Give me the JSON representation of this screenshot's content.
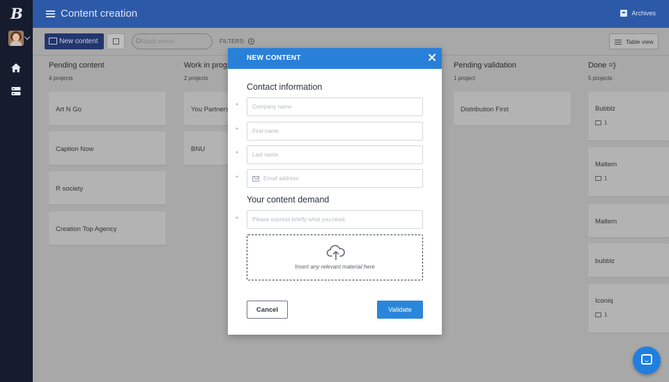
{
  "sidebar": {
    "logo_letter": "B",
    "icons": [
      "home-icon",
      "storage-icon"
    ]
  },
  "topbar": {
    "title": "Content creation",
    "archives_label": "Archives"
  },
  "toolbar": {
    "new_content_label": "New content",
    "search_placeholder": "Rapid search",
    "filters_label": "FILTERS:",
    "filters_add": "+",
    "table_view_label": "Table view"
  },
  "board": {
    "columns": [
      {
        "title": "Pending content",
        "count": "4 projects",
        "cards": [
          {
            "name": "Art N Go"
          },
          {
            "name": "Caption Now"
          },
          {
            "name": "R society"
          },
          {
            "name": "Creation Top Agency"
          }
        ]
      },
      {
        "title": "Work in progress",
        "count": "2 projects",
        "cards": [
          {
            "name": "You Partners"
          },
          {
            "name": "BNU"
          }
        ]
      },
      {
        "title": "Pending validation",
        "count": "1 project",
        "cards": [
          {
            "name": "Distribution First"
          }
        ]
      },
      {
        "title": "Done =)",
        "count": "5 projects",
        "cards": [
          {
            "name": "Bubblz",
            "comments": "1"
          },
          {
            "name": "Maltem",
            "comments": "1"
          },
          {
            "name": "Maltem"
          },
          {
            "name": "bubblz"
          },
          {
            "name": "Iconiq",
            "comments": "1"
          }
        ]
      }
    ]
  },
  "modal": {
    "title": "NEW CONTENT",
    "contact_section": "Contact information",
    "required_marker": "*",
    "fields": {
      "company_placeholder": "Company name",
      "first_name_placeholder": "First name",
      "last_name_placeholder": "Last name",
      "email_placeholder": "Email address",
      "demand_placeholder": "Please express briefly what you need"
    },
    "demand_section": "Your content demand",
    "dropzone_hint": "Insert any relevant material here",
    "cancel_label": "Cancel",
    "validate_label": "Validate"
  },
  "colors": {
    "topbar": "#2d5aa8",
    "sidebar": "#161b2e",
    "modal_header": "#2980d9",
    "validate_button": "#2a86db",
    "chat_button": "#1f7fe0"
  }
}
